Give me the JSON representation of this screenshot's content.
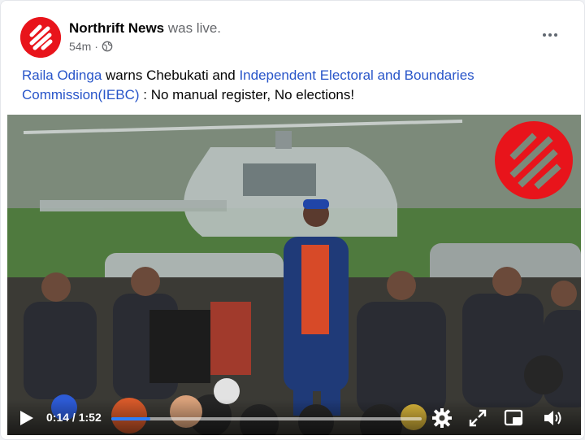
{
  "post": {
    "page_name": "Northrift News",
    "live_status": " was live.",
    "time_ago": "54m",
    "separator": "·",
    "privacy_icon": "globe-icon",
    "more_icon": "more-options-icon"
  },
  "caption": {
    "link1": "Raila Odinga",
    "text1": "  warns Chebukati and ",
    "link2": "Independent Electoral and Boundaries Commission(IEBC)",
    "text2": " : No manual register, No elections!"
  },
  "video": {
    "current_time": "0:14",
    "duration": "1:52",
    "time_separator": " / ",
    "progress_fraction": 0.125,
    "icons": [
      "play-icon",
      "settings-icon",
      "fullscreen-icon",
      "miniplayer-icon",
      "volume-icon"
    ]
  },
  "colors": {
    "brand_red": "#e8141b",
    "link_blue": "#2855c9",
    "progress_blue": "#2d7ff9"
  }
}
